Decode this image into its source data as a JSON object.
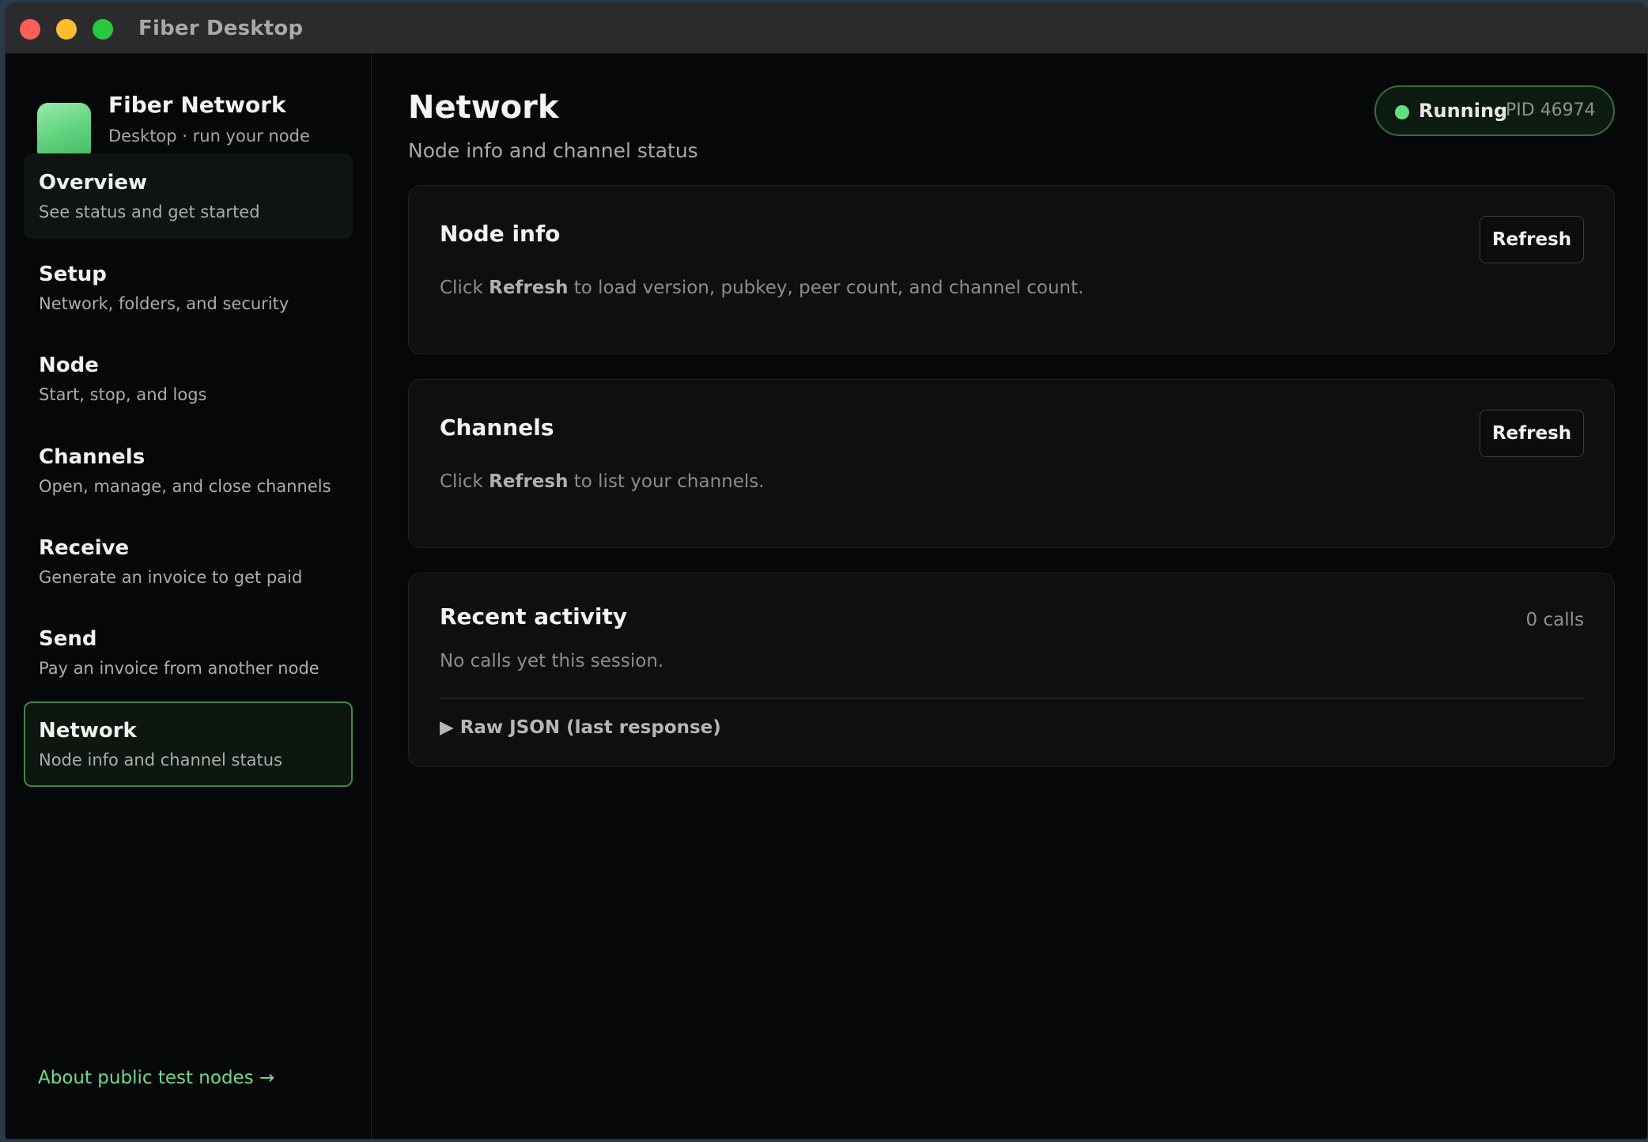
{
  "window": {
    "title": "Fiber Desktop"
  },
  "brand": {
    "name": "Fiber Network",
    "subtitle": "Desktop · run your node locally"
  },
  "sidebar": {
    "items": [
      {
        "title": "Overview",
        "desc": "See status and get started"
      },
      {
        "title": "Setup",
        "desc": "Network, folders, and security"
      },
      {
        "title": "Node",
        "desc": "Start, stop, and logs"
      },
      {
        "title": "Channels",
        "desc": "Open, manage, and close channels"
      },
      {
        "title": "Receive",
        "desc": "Generate an invoice to get paid"
      },
      {
        "title": "Send",
        "desc": "Pay an invoice from another node"
      },
      {
        "title": "Network",
        "desc": "Node info and channel status"
      }
    ],
    "active": "Network",
    "footer_link": "About public test nodes →"
  },
  "header": {
    "title": "Network",
    "subtitle": "Node info and channel status",
    "status": {
      "label": "Running",
      "pid": "PID 46974"
    }
  },
  "cards": {
    "node_info": {
      "title": "Node info",
      "button": "Refresh",
      "text_prefix": "Click ",
      "text_bold": "Refresh",
      "text_suffix": " to load version, pubkey, peer count, and channel count."
    },
    "channels": {
      "title": "Channels",
      "button": "Refresh",
      "text_prefix": "Click ",
      "text_bold": "Refresh",
      "text_suffix": " to list your channels."
    },
    "activity": {
      "title": "Recent activity",
      "count": "0 calls",
      "empty": "No calls yet this session.",
      "raw_json": "▶ Raw JSON (last response)"
    }
  },
  "colors": {
    "accent": "#5ee27d",
    "link": "#6fdc8a",
    "background": "#060708"
  }
}
